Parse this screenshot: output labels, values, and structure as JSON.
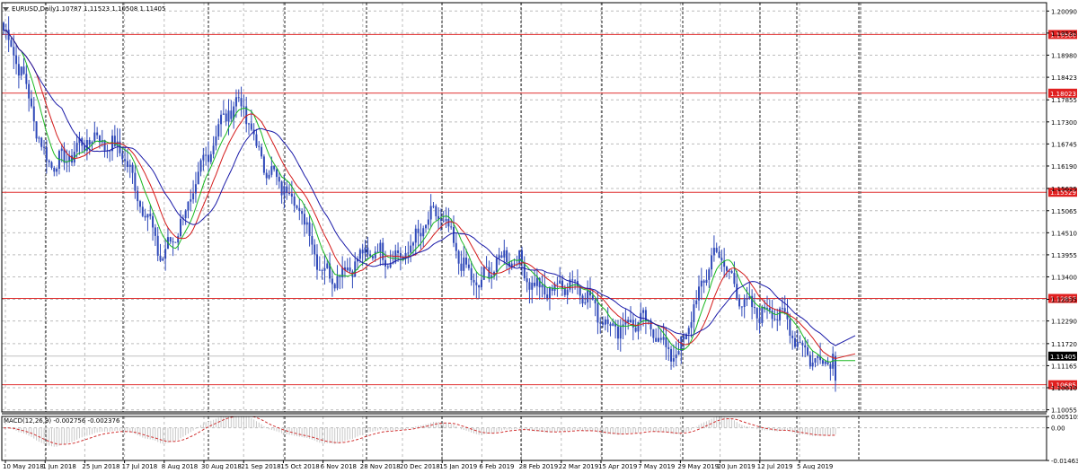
{
  "chart_header": {
    "symbol_timeframe": "EURUSD,Daily",
    "ohlc": "1.10787 1.11523 1.10508 1.11405"
  },
  "macd_header": {
    "label": "MACD(12,26,9) -0.002756 -0.002376"
  },
  "colors": {
    "candles": "#2f49b9",
    "ma_fast": "#18b81e",
    "ma_mid": "#d41a1a",
    "ma_slow": "#1a1aa8",
    "level_line": "#e03030",
    "level_label_bg": "#e02020",
    "price_label_bg": "#000000",
    "grid": "#bcbcbc",
    "signal": "#d03030",
    "histogram": "#c8c8c8"
  },
  "chart_data": [
    {
      "type": "candlestick",
      "title": "EURUSD,Daily",
      "x_tick_labels": [
        "10 May 2018",
        "1 Jun 2018",
        "25 Jun 2018",
        "17 Jul 2018",
        "8 Aug 2018",
        "30 Aug 2018",
        "21 Sep 2018",
        "15 Oct 2018",
        "6 Nov 2018",
        "28 Nov 2018",
        "20 Dec 2018",
        "15 Jan 2019",
        "6 Feb 2019",
        "28 Feb 2019",
        "22 Mar 2019",
        "15 Apr 2019",
        "7 May 2019",
        "29 May 2019",
        "20 Jun 2019",
        "12 Jul 2019",
        "5 Aug 2019"
      ],
      "y_tick_labels": [
        "1.20090",
        "1.19535",
        "1.18980",
        "1.18423",
        "1.17855",
        "1.17300",
        "1.16745",
        "1.16190",
        "1.15625",
        "1.15065",
        "1.14510",
        "1.13955",
        "1.13400",
        "1.12835",
        "1.12290",
        "1.11720",
        "1.11165",
        "1.10610",
        "1.10055"
      ],
      "ylim": [
        1.1,
        1.203
      ],
      "horizontal_levels": [
        "1.19500",
        "1.18023",
        "1.15529",
        "1.12857",
        "1.10685"
      ],
      "current_price": "1.11405",
      "last_candle": {
        "open": 1.10787,
        "high": 1.11523,
        "low": 1.10508,
        "close": 1.11405
      },
      "close_path": [
        {
          "date": "10 May 2018",
          "close": 1.196
        },
        {
          "date": "1 Jun 2018",
          "close": 1.166
        },
        {
          "date": "25 Jun 2018",
          "close": 1.165
        },
        {
          "date": "17 Jul 2018",
          "close": 1.169
        },
        {
          "date": "8 Aug 2018",
          "close": 1.135
        },
        {
          "date": "30 Aug 2018",
          "close": 1.164
        },
        {
          "date": "21 Sep 2018",
          "close": 1.177
        },
        {
          "date": "15 Oct 2018",
          "close": 1.157
        },
        {
          "date": "6 Nov 2018",
          "close": 1.138
        },
        {
          "date": "28 Nov 2018",
          "close": 1.136
        },
        {
          "date": "20 Dec 2018",
          "close": 1.142
        },
        {
          "date": "15 Jan 2019",
          "close": 1.147
        },
        {
          "date": "6 Feb 2019",
          "close": 1.134
        },
        {
          "date": "28 Feb 2019",
          "close": 1.137
        },
        {
          "date": "22 Mar 2019",
          "close": 1.131
        },
        {
          "date": "15 Apr 2019",
          "close": 1.127
        },
        {
          "date": "7 May 2019",
          "close": 1.12
        },
        {
          "date": "29 May 2019",
          "close": 1.117
        },
        {
          "date": "20 Jun 2019",
          "close": 1.138
        },
        {
          "date": "12 Jul 2019",
          "close": 1.127
        },
        {
          "date": "5 Aug 2019",
          "close": 1.118
        },
        {
          "date": "last",
          "close": 1.11405
        }
      ]
    },
    {
      "type": "histogram",
      "title": "MACD(12,26,9)",
      "y_tick_labels": [
        "0.005105",
        "0.00",
        "-0.014635"
      ],
      "ylim": [
        -0.0146,
        0.0051
      ],
      "current_values": {
        "macd": -0.002756,
        "signal": -0.002376
      }
    }
  ]
}
